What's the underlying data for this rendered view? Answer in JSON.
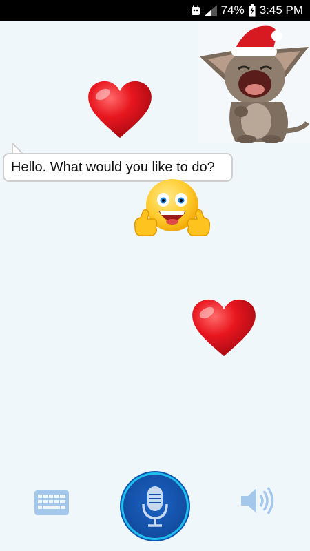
{
  "status_bar": {
    "battery_percent": "74%",
    "time": "3:45 PM",
    "icons": [
      "android-notification-icon",
      "signal-icon",
      "battery-icon"
    ]
  },
  "chat": {
    "bot_message": "Hello. What would you like to do?"
  },
  "stickers": [
    "red-heart",
    "talking-cat-santa-hat",
    "thumbs-up-emoji",
    "red-heart"
  ],
  "controls": {
    "keyboard_icon": "keyboard-icon",
    "mic_icon": "microphone-icon",
    "speaker_icon": "speaker-icon"
  },
  "colors": {
    "background": "#f0f7fb",
    "heart": "#e01822",
    "mic_button": "#1450a7",
    "mic_ring": "#1ec0ee",
    "bottom_icons": "#a3c8ec"
  }
}
